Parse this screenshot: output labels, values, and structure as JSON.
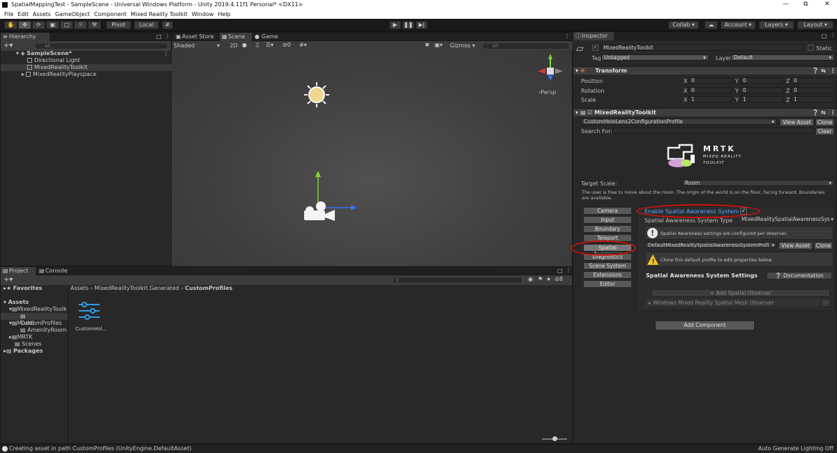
{
  "titlebar": {
    "title": "SpatialMappingTest - SampleScene - Universal Windows Platform - Unity 2019.4.11f1 Personal* <DX11>"
  },
  "menu": [
    "File",
    "Edit",
    "Assets",
    "GameObject",
    "Component",
    "Mixed Reality Toolkit",
    "Window",
    "Help"
  ],
  "toolbar": {
    "pivot": "Pivot",
    "local": "Local",
    "collab": "Collab",
    "account": "Account",
    "layers": "Layers",
    "layout": "Layout"
  },
  "hierarchy": {
    "tab": "Hierarchy",
    "search_placeholder": "All",
    "scene": "SampleScene*",
    "items": [
      "Directional Light",
      "MixedRealityToolkit",
      "MixedRealityPlayspace"
    ]
  },
  "scene_view": {
    "tabs": [
      "Asset Store",
      "Scene",
      "Game"
    ],
    "shading": "Shaded",
    "mode2d": "2D",
    "fx_count": "0",
    "gizmos": "Gizmos",
    "search_placeholder": "All",
    "persp": "Persp"
  },
  "project": {
    "tabs": [
      "Project",
      "Console"
    ],
    "favorites": "Favorites",
    "tree": [
      "Assets",
      "MixedRealityToolk",
      "CustomProfiles",
      "Model",
      "AmenityRoom",
      "MRTK",
      "Scenes",
      "Packages"
    ],
    "breadcrumb": [
      "Assets",
      "MixedRealityToolkit.Generated",
      "CustomProfiles"
    ],
    "asset_name": "CustomHol...",
    "hidden_count": "8"
  },
  "inspector": {
    "tab": "Inspector",
    "object_name": "MixedRealityToolkit",
    "static": "Static",
    "tag_label": "Tag",
    "tag_value": "Untagged",
    "layer_label": "Layer",
    "layer_value": "Default",
    "transform": {
      "title": "Transform",
      "rows": [
        {
          "label": "Position",
          "x": "0",
          "y": "0",
          "z": "0"
        },
        {
          "label": "Rotation",
          "x": "0",
          "y": "0",
          "z": "0"
        },
        {
          "label": "Scale",
          "x": "1",
          "y": "1",
          "z": "1"
        }
      ],
      "axes": [
        "X",
        "Y",
        "Z"
      ]
    },
    "component": {
      "title": "MixedRealityToolkit",
      "profile": "CustomHoloLens2ConfigurationProfile",
      "view_asset": "View Asset",
      "clone": "Clone",
      "search_for": "Search For:",
      "clear": "Clear",
      "logo_title": "MRTK",
      "logo_sub1": "MIXED REALITY",
      "logo_sub2": "TOOLKIT",
      "target_scale_label": "Target Scale:",
      "target_scale_value": "Room",
      "target_scale_desc": "The user is free to move about the room. The origin of the world is on the floor, facing forward. Boundaries are available.",
      "nav": [
        "Camera",
        "Input",
        "Boundary",
        "Teleport",
        "Spatial Awareness",
        "Diagnostics",
        "Scene System",
        "Extensions",
        "Editor"
      ],
      "enable_sa": "Enable Spatial Awareness System",
      "sa_type_label": "Spatial Awareness System Type",
      "sa_type_value": "MixedRealitySpatialAwarenessSys",
      "sa_info": "Spatial Awareness settings are configured per observer.",
      "sa_profile": "DefaultMixedRealitySpatialAwarenessSystemProfi",
      "sa_warning": "Clone this default profile to edit properties below",
      "sa_settings": "Spatial Awareness System Settings",
      "documentation": "Documentation",
      "add_observer": "+ Add Spatial Observer",
      "observer": "Windows Mixed Reality Spatial Mesh Observer",
      "observer_remove": "-"
    },
    "add_component": "Add Component"
  },
  "status": {
    "message": "Creating asset in path CustomProfiles (UnityEngine.DefaultAsset)",
    "right": "Auto Generate Lighting Off"
  }
}
